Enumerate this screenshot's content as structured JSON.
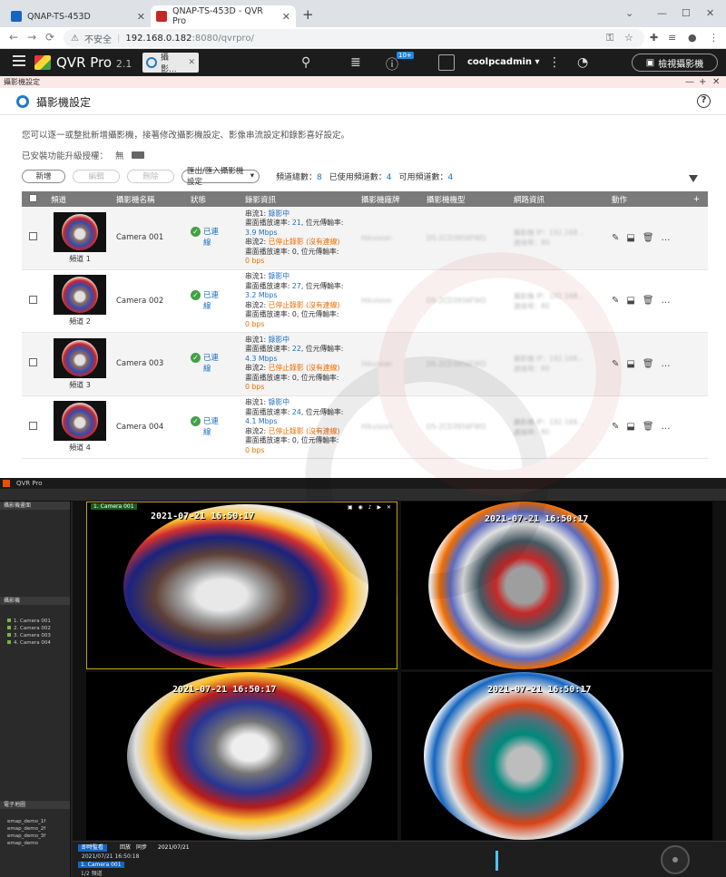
{
  "browser": {
    "tabs": [
      {
        "title": "QNAP-TS-453D"
      },
      {
        "title": "QNAP-TS-453D - QVR Pro"
      }
    ],
    "address": {
      "insecure_label": "不安全",
      "host": "192.168.0.182",
      "path": ":8080/qvrpro/"
    }
  },
  "qvr": {
    "app_name": "QVR Pro",
    "version": "2.1",
    "active_tab": "攝影...",
    "notification_badge": "10+",
    "username": "coolpcadmin",
    "monitor_button": "檢視攝影機"
  },
  "window": {
    "title": "攝影機設定"
  },
  "page": {
    "title": "攝影機設定",
    "description": "您可以逐一或整批新增攝影機，接著修改攝影機設定、影像串流設定和錄影喜好設定。",
    "license_label": "已安裝功能升級授權：",
    "license_value": "無"
  },
  "toolbar": {
    "add": "新增",
    "edit": "編輯",
    "delete": "刪除",
    "import_export": "匯出/匯入攝影機設定",
    "total_label": "頻道總數：",
    "total_value": "8",
    "used_label": "已使用頻道數：",
    "used_value": "4",
    "available_label": "可用頻道數：",
    "available_value": "4"
  },
  "table": {
    "headers": [
      "頻道",
      "攝影機名稱",
      "狀態",
      "錄影資訊",
      "攝影機廠牌",
      "攝影機機型",
      "網路資訊",
      "動作",
      "+"
    ],
    "rows": [
      {
        "channel": "頻道 1",
        "name": "Camera 001",
        "status": "已連線",
        "s1_prefix": "串流1: ",
        "s1_state": "錄影中",
        "fps1_prefix": "畫面播放速率: ",
        "fps1": "21",
        "br_label": ", 位元傳輸率:",
        "bitrate1": "3.9 Mbps",
        "s2_prefix": "串流2: ",
        "s2_state": "已停止錄影 (沒有連線)",
        "fps2_text": "畫面播放速率: 0, 位元傳輸率:",
        "bitrate2": "0 bps",
        "brand": "Hikvision",
        "model": "DS-2CD3956FWD",
        "net1": "攝影機 IP：192.168...",
        "net2": "連接埠：80"
      },
      {
        "channel": "頻道 2",
        "name": "Camera 002",
        "status": "已連線",
        "s1_prefix": "串流1: ",
        "s1_state": "錄影中",
        "fps1_prefix": "畫面播放速率: ",
        "fps1": "27",
        "br_label": ", 位元傳輸率:",
        "bitrate1": "3.2 Mbps",
        "s2_prefix": "串流2: ",
        "s2_state": "已停止錄影 (沒有連線)",
        "fps2_text": "畫面播放速率: 0, 位元傳輸率:",
        "bitrate2": "0 bps",
        "brand": "Hikvision",
        "model": "DS-2CD3956FWD",
        "net1": "攝影機 IP：192.168...",
        "net2": "連接埠：80"
      },
      {
        "channel": "頻道 3",
        "name": "Camera 003",
        "status": "已連線",
        "s1_prefix": "串流1: ",
        "s1_state": "錄影中",
        "fps1_prefix": "畫面播放速率: ",
        "fps1": "22",
        "br_label": ", 位元傳輸率:",
        "bitrate1": "4.3 Mbps",
        "s2_prefix": "串流2: ",
        "s2_state": "已停止錄影 (沒有連線)",
        "fps2_text": "畫面播放速率: 0, 位元傳輸率:",
        "bitrate2": "0 bps",
        "brand": "Hikvision",
        "model": "DS-2CD3956FWD",
        "net1": "攝影機 IP：192.168...",
        "net2": "連接埠：80"
      },
      {
        "channel": "頻道 4",
        "name": "Camera 004",
        "status": "已連線",
        "s1_prefix": "串流1: ",
        "s1_state": "錄影中",
        "fps1_prefix": "畫面播放速率: ",
        "fps1": "24",
        "br_label": ", 位元傳輸率:",
        "bitrate1": "4.1 Mbps",
        "s2_prefix": "串流2: ",
        "s2_state": "已停止錄影 (沒有連線)",
        "fps2_text": "畫面播放速率: 0, 位元傳輸率:",
        "bitrate2": "0 bps",
        "brand": "Hikvision",
        "model": "DS-2CD3956FWD",
        "net1": "攝影機 IP：192.168...",
        "net2": "連接埠：80"
      }
    ]
  },
  "client": {
    "title": "QVR Pro",
    "side_sections": [
      "攝影機畫面",
      "攝影機",
      "電子地圖"
    ],
    "side_cameras": [
      "1. Camera 001",
      "2. Camera 002",
      "3. Camera 003",
      "4. Camera 004"
    ],
    "maps": [
      "emap_demo_1f",
      "emap_demo_2f",
      "emap_demo_3f",
      "emap_demo"
    ],
    "panes": [
      {
        "label": "1. Camera 001",
        "timestamp": "2021-07-21 16:50:17"
      },
      {
        "label": "",
        "timestamp": "2021-07-21 16:50:17"
      },
      {
        "label": "",
        "timestamp": "2021-07-21 16:50:17"
      },
      {
        "label": "",
        "timestamp": "2021-07-21 16:50:17"
      }
    ],
    "timeline": {
      "tab_live": "即時監看",
      "tab_playback": "回放",
      "tab_sync": "同步",
      "date": "2021/07/21",
      "datetime": "2021/07/21 16:50:18",
      "camera": "1. Camera 001",
      "stream": "1/2 頻道"
    }
  },
  "colors": {
    "accent": "#1e6fc2",
    "ok": "#43a047",
    "warning": "#ef6c00",
    "header": "#1c1c1c"
  }
}
